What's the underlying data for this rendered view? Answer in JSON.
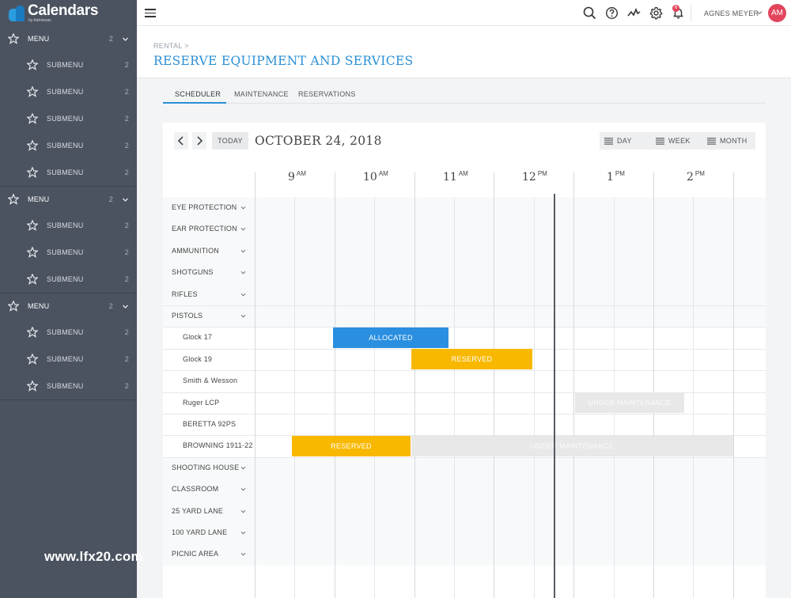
{
  "app": {
    "name": "Calendars",
    "byline": "by Adminsan"
  },
  "sidebar": {
    "groups": [
      {
        "label": "MENU",
        "count": "2",
        "subs": [
          {
            "label": "SUBMENU",
            "count": "2"
          },
          {
            "label": "SUBMENU",
            "count": "2"
          },
          {
            "label": "SUBMENU",
            "count": "2"
          },
          {
            "label": "SUBMENU",
            "count": "2"
          },
          {
            "label": "SUBMENU",
            "count": "2"
          }
        ]
      },
      {
        "label": "MENU",
        "count": "2",
        "subs": [
          {
            "label": "SUBMENU",
            "count": "2"
          },
          {
            "label": "SUBMENU",
            "count": "2"
          },
          {
            "label": "SUBMENU",
            "count": "2"
          }
        ]
      },
      {
        "label": "MENU",
        "count": "2",
        "subs": [
          {
            "label": "SUBMENU",
            "count": "2"
          },
          {
            "label": "SUBMENU",
            "count": "2"
          },
          {
            "label": "SUBMENU",
            "count": "2"
          }
        ]
      }
    ]
  },
  "topbar": {
    "notification_count": "6",
    "user_name": "AGNES MEYER",
    "user_initials": "AM"
  },
  "header": {
    "breadcrumb": "RENTAL >",
    "title": "RESERVE EQUIPMENT AND SERVICES"
  },
  "tabs": [
    "SCHEDULER",
    "MAINTENANCE",
    "RESERVATIONS"
  ],
  "scheduler": {
    "today_label": "TODAY",
    "date": "OCTOBER 24, 2018",
    "views": [
      "DAY",
      "WEEK",
      "MONTH"
    ],
    "hours": [
      {
        "num": "9",
        "ampm": "AM"
      },
      {
        "num": "10",
        "ampm": "AM"
      },
      {
        "num": "11",
        "ampm": "AM"
      },
      {
        "num": "12",
        "ampm": "PM"
      },
      {
        "num": "1",
        "ampm": "PM"
      },
      {
        "num": "2",
        "ampm": "PM"
      }
    ],
    "rows": [
      {
        "label": "EYE PROTECTION",
        "expandable": true,
        "child": false
      },
      {
        "label": "EAR PROTECTION",
        "expandable": true,
        "child": false
      },
      {
        "label": "AMMUNITION",
        "expandable": true,
        "child": false
      },
      {
        "label": "SHOTGUNS",
        "expandable": true,
        "child": false
      },
      {
        "label": "RIFLES",
        "expandable": true,
        "child": false
      },
      {
        "label": "PISTOLS",
        "expandable": true,
        "child": false
      },
      {
        "label": "Glock 17",
        "expandable": false,
        "child": true
      },
      {
        "label": "Glock 19",
        "expandable": false,
        "child": true
      },
      {
        "label": "Smith & Wesson",
        "expandable": false,
        "child": true
      },
      {
        "label": "Ruger LCP",
        "expandable": false,
        "child": true
      },
      {
        "label": "BERETTA 92PS",
        "expandable": false,
        "child": true
      },
      {
        "label": "BROWNING 1911-22",
        "expandable": false,
        "child": true
      },
      {
        "label": "SHOOTING HOUSE",
        "expandable": true,
        "child": false
      },
      {
        "label": "CLASSROOM",
        "expandable": true,
        "child": false
      },
      {
        "label": "25 YARD LANE",
        "expandable": true,
        "child": false
      },
      {
        "label": "100 YARD LANE",
        "expandable": true,
        "child": false
      },
      {
        "label": "PICNIC AREA",
        "expandable": true,
        "child": false
      }
    ],
    "events": [
      {
        "row": 6,
        "label": "ALLOCATED",
        "kind": "allocated",
        "start": "9:59",
        "end": "11:26"
      },
      {
        "row": 7,
        "label": "RESERVED",
        "kind": "reserved",
        "start": "10:58",
        "end": "12:29"
      },
      {
        "row": 9,
        "label": "UNDER MAINTENANCE",
        "kind": "maint",
        "start": "13:01",
        "end": "14:23"
      },
      {
        "row": 11,
        "label": "RESERVED",
        "kind": "reserved",
        "start": "9:28",
        "end": "10:57"
      },
      {
        "row": 11,
        "label": "UNDER MAINTENANCE",
        "kind": "maint",
        "start": "10:58",
        "end": "15:00"
      }
    ],
    "now": "12:45"
  },
  "watermark": "www.lfx20.com",
  "colors": {
    "accent": "#2a8fd6",
    "allocated": "#2a8fe0",
    "reserved": "#f8b800",
    "maintenance": "#e8e8e8",
    "sidebar": "#4b5360",
    "badge": "#e2445c"
  }
}
